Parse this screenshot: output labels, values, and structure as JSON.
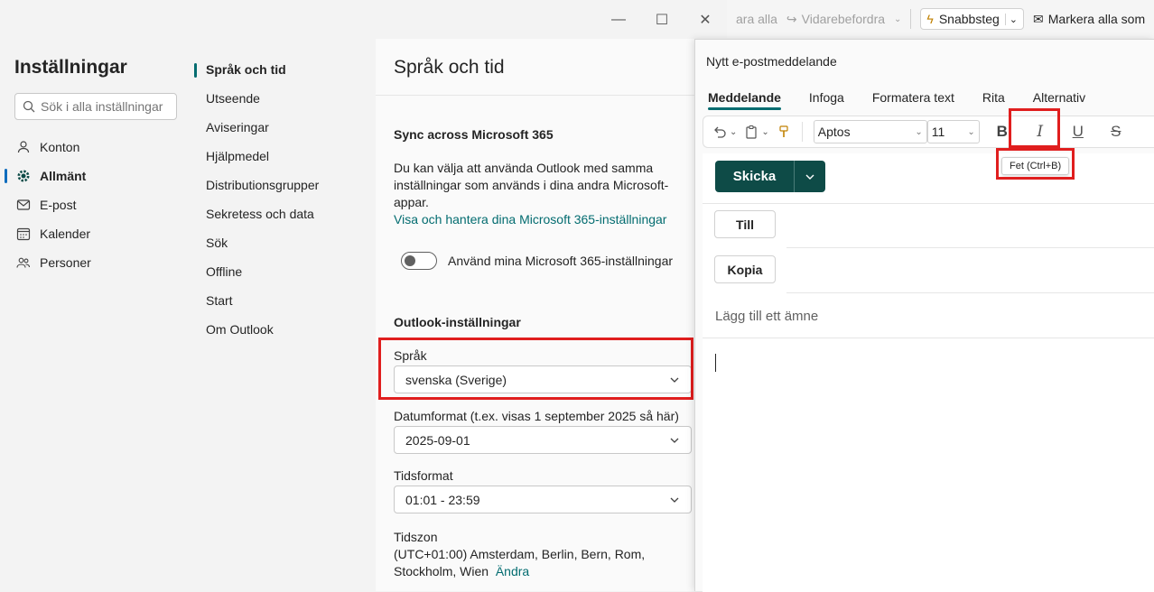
{
  "bg_toolbar": {
    "reply_all": "ara alla",
    "forward": "Vidarebefordra",
    "quicksteps": "Snabbsteg",
    "mark_all": "Markera alla som"
  },
  "settings": {
    "title": "Inställningar",
    "search_placeholder": "Sök i alla inställningar",
    "nav": [
      {
        "label": "Konton",
        "icon": "person-icon"
      },
      {
        "label": "Allmänt",
        "icon": "gear-icon"
      },
      {
        "label": "E-post",
        "icon": "mail-icon"
      },
      {
        "label": "Kalender",
        "icon": "calendar-icon"
      },
      {
        "label": "Personer",
        "icon": "people-icon"
      }
    ],
    "sub_nav": [
      "Språk och tid",
      "Utseende",
      "Aviseringar",
      "Hjälpmedel",
      "Distributionsgrupper",
      "Sekretess och data",
      "Sök",
      "Offline",
      "Start",
      "Om Outlook"
    ],
    "content": {
      "title": "Språk och tid",
      "sync_heading": "Sync across Microsoft 365",
      "sync_text": "Du kan välja att använda Outlook med samma inställningar som används i dina andra Microsoft-appar.",
      "sync_link": "Visa och hantera dina Microsoft 365-inställningar",
      "toggle_label": "Använd mina Microsoft 365-inställningar",
      "outlook_heading": "Outlook-inställningar",
      "language_label": "Språk",
      "language_value": "svenska (Sverige)",
      "date_label": "Datumformat (t.ex. visas 1 september 2025 så här)",
      "date_value": "2025-09-01",
      "time_label": "Tidsformat",
      "time_value": "01:01 - 23:59",
      "tz_label": "Tidszon",
      "tz_value_1": "(UTC+01:00) Amsterdam, Berlin, Bern, Rom,",
      "tz_value_2": "Stockholm, Wien",
      "tz_change": "Ändra"
    }
  },
  "compose": {
    "title": "Nytt e-postmeddelande",
    "tabs": [
      "Meddelande",
      "Infoga",
      "Formatera text",
      "Rita",
      "Alternativ"
    ],
    "font": "Aptos",
    "font_size": "11",
    "bold_glyph": "B",
    "italic_glyph": "I",
    "underline_glyph": "U",
    "strike_glyph": "S",
    "tooltip": "Fet (Ctrl+B)",
    "send": "Skicka",
    "to": "Till",
    "cc": "Kopia",
    "subject_placeholder": "Lägg till ett ämne"
  },
  "highlight_color": "#e01e1e",
  "accent_color": "#036c70"
}
